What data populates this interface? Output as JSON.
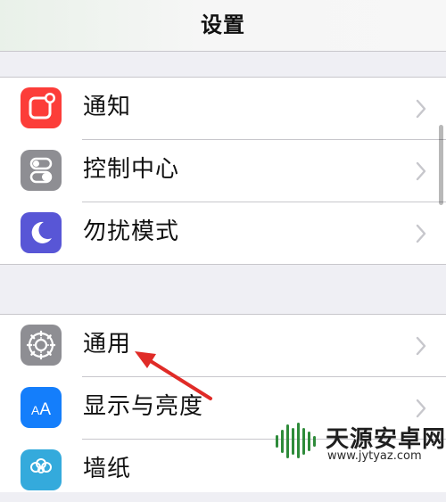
{
  "nav": {
    "title": "设置"
  },
  "groups": [
    {
      "items": [
        {
          "label": "通知",
          "icon": "notifications-icon",
          "color": "#fc3d39"
        },
        {
          "label": "控制中心",
          "icon": "control-center-icon",
          "color": "#8e8e93"
        },
        {
          "label": "勿扰模式",
          "icon": "do-not-disturb-icon",
          "color": "#5856d6"
        }
      ]
    },
    {
      "items": [
        {
          "label": "通用",
          "icon": "gear-icon",
          "color": "#8e8e93"
        },
        {
          "label": "显示与亮度",
          "icon": "display-brightness-icon",
          "color": "#147efb"
        },
        {
          "label": "墙纸",
          "icon": "wallpaper-icon",
          "color": "#34aadc"
        }
      ]
    }
  ],
  "annotation": {
    "arrow_color": "#e02b27"
  },
  "watermark": {
    "name": "天源安卓网",
    "url": "www.jytyaz.com",
    "logo_color": "#2e8b3a"
  }
}
